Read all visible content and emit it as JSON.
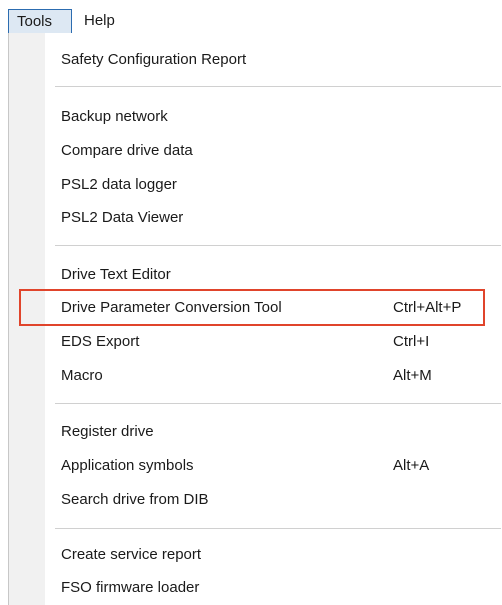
{
  "menubar": {
    "tools_label": "Tools",
    "help_label": "Help"
  },
  "tools_menu": {
    "groups": [
      {
        "items": [
          {
            "label": "Safety Configuration Report",
            "shortcut": ""
          }
        ]
      },
      {
        "items": [
          {
            "label": "Backup network",
            "shortcut": ""
          },
          {
            "label": "Compare drive data",
            "shortcut": ""
          },
          {
            "label": "PSL2 data logger",
            "shortcut": ""
          },
          {
            "label": "PSL2 Data Viewer",
            "shortcut": ""
          }
        ]
      },
      {
        "items": [
          {
            "label": "Drive Text Editor",
            "shortcut": ""
          },
          {
            "label": "Drive Parameter Conversion Tool",
            "shortcut": "Ctrl+Alt+P",
            "highlighted": true
          },
          {
            "label": "EDS Export",
            "shortcut": "Ctrl+I"
          },
          {
            "label": "Macro",
            "shortcut": "Alt+M"
          }
        ]
      },
      {
        "items": [
          {
            "label": "Register drive",
            "shortcut": ""
          },
          {
            "label": "Application symbols",
            "shortcut": "Alt+A"
          },
          {
            "label": "Search drive from DIB",
            "shortcut": ""
          }
        ]
      },
      {
        "items": [
          {
            "label": "Create service report",
            "shortcut": ""
          },
          {
            "label": "FSO firmware loader",
            "shortcut": ""
          }
        ]
      }
    ]
  },
  "colors": {
    "highlight_border": "#e0442b",
    "active_menu_bg": "#dde8f3",
    "active_menu_border": "#2c6cb0"
  }
}
